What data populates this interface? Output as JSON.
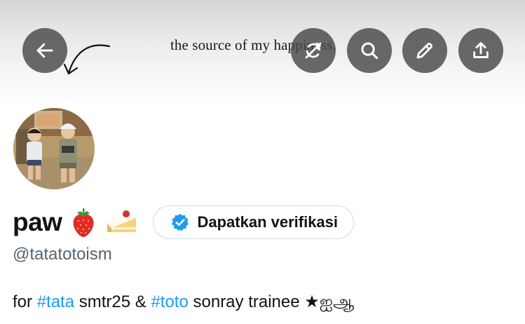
{
  "header": {
    "banner_text": "the source of my happiness.",
    "buttons": {
      "back": "arrow-left-icon",
      "sync": "sync-off-icon",
      "search": "search-icon",
      "edit": "pencil-icon",
      "share": "share-icon"
    }
  },
  "profile": {
    "display_name": "paw",
    "emojis": [
      "strawberry",
      "shortcake"
    ],
    "verify_label": "Dapatkan verifikasi",
    "handle": "@tatatotoism",
    "bio": {
      "t1": "for ",
      "tag1": "#tata",
      "t2": " smtr25 & ",
      "tag2": "#toto",
      "t3": " sonray trainee ★ஐஆ"
    }
  },
  "colors": {
    "accent": "#1d9bf0",
    "text": "#0f1419",
    "muted": "#536471",
    "button_overlay": "#484848",
    "border": "#cfd9de"
  }
}
